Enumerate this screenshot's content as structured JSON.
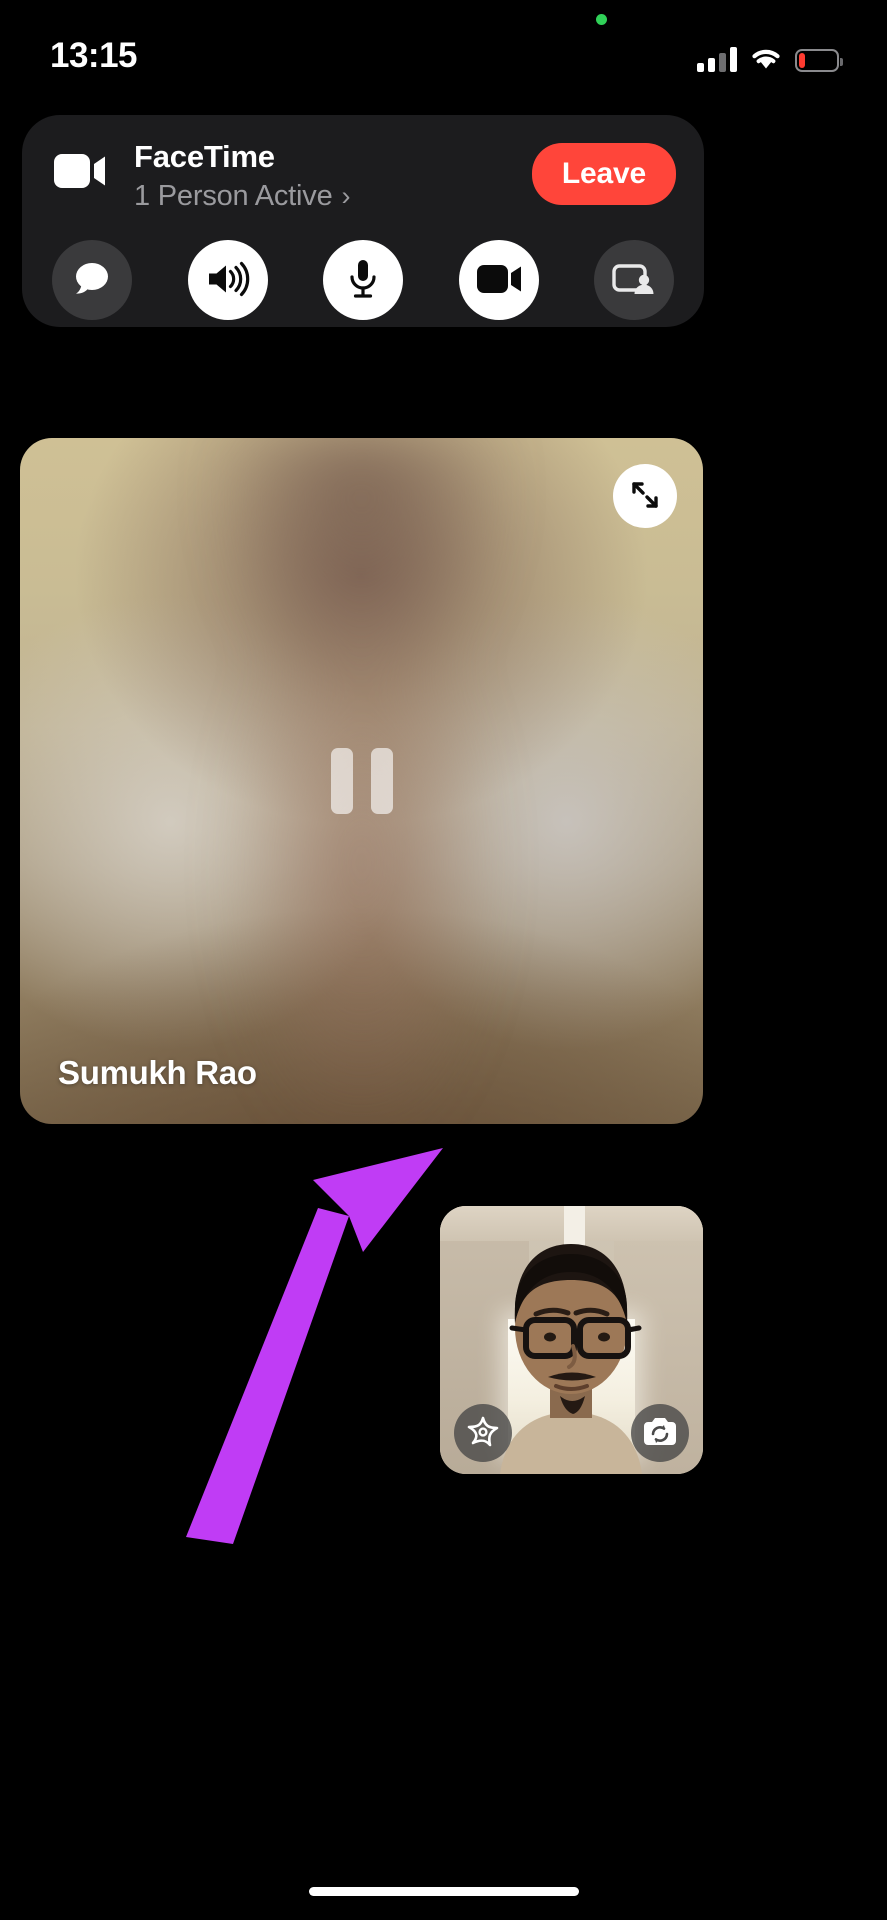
{
  "status_bar": {
    "time": "13:15",
    "privacy_indicator": "green-recording-dot",
    "cellular_icon": "cellular-signal-icon",
    "cellular_bars_filled": 2,
    "cellular_bars_total": 4,
    "wifi_icon": "wifi-icon",
    "battery_icon": "battery-icon",
    "battery_level_percent": 18,
    "battery_color": "#ff3b30"
  },
  "facetime_banner": {
    "app_icon": "video-camera-icon",
    "title": "FaceTime",
    "subtitle": "1 Person Active",
    "subtitle_chevron": "chevron-right-icon",
    "leave_label": "Leave",
    "leave_color": "#ff453a",
    "background_color": "#1c1c1e",
    "controls": [
      {
        "name": "messages-button",
        "icon": "chat-bubble-icon",
        "style": "dark",
        "state": "off"
      },
      {
        "name": "speaker-button",
        "icon": "speaker-wave-icon",
        "style": "light",
        "state": "on"
      },
      {
        "name": "microphone-button",
        "icon": "microphone-icon",
        "style": "light",
        "state": "on"
      },
      {
        "name": "camera-button",
        "icon": "video-camera-icon",
        "style": "light",
        "state": "on"
      },
      {
        "name": "shareplay-button",
        "icon": "screen-share-person-icon",
        "style": "dark",
        "state": "off"
      }
    ]
  },
  "remote_video": {
    "participant_name": "Sumukh Rao",
    "state_icon": "pause-icon",
    "state": "paused",
    "expand_button_icon": "expand-diagonal-arrows-icon",
    "blur": "heavily-blurred-video"
  },
  "annotation": {
    "type": "arrow",
    "color": "#c03cf5",
    "points_to": "pause-icon",
    "description": "purple arrow pointing to paused video indicator"
  },
  "pip_self_view": {
    "label": "self-camera-preview",
    "buttons": [
      {
        "name": "effects-button",
        "icon": "sparkle-star-effects-icon"
      },
      {
        "name": "flip-camera-button",
        "icon": "camera-flip-icon"
      }
    ]
  },
  "home_indicator": {
    "name": "home-indicator"
  }
}
